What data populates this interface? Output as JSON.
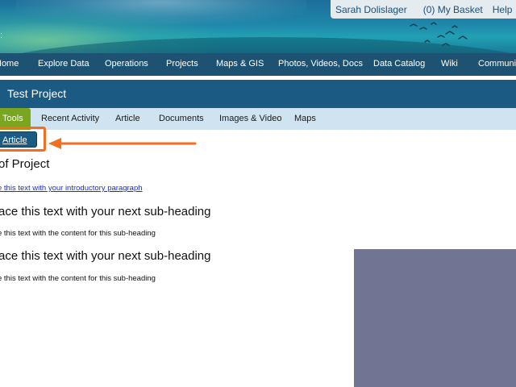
{
  "header": {
    "user_name": "Sarah Dolislager",
    "basket_label": "(0) My Basket",
    "help_label": "Help",
    "icons": {
      "settings": "gear-icon",
      "basket": "cart-icon"
    }
  },
  "main_nav": {
    "items": [
      {
        "label": "Home"
      },
      {
        "label": "Explore Data"
      },
      {
        "label": "Operations"
      },
      {
        "label": "Projects"
      },
      {
        "label": "Maps & GIS"
      },
      {
        "label": "Photos, Videos, Docs"
      },
      {
        "label": "Data Catalog"
      },
      {
        "label": "Wiki"
      },
      {
        "label": "Community"
      }
    ]
  },
  "project": {
    "title": "Test Project"
  },
  "sub_tabs": {
    "items": [
      {
        "label": "Tools",
        "active": true
      },
      {
        "label": "Recent Activity"
      },
      {
        "label": "Article"
      },
      {
        "label": "Documents"
      },
      {
        "label": "Images & Video"
      },
      {
        "label": "Maps"
      }
    ]
  },
  "action": {
    "label": "Article"
  },
  "article": {
    "heading": "of Project",
    "intro_link": "e this text with your introductory paragraph",
    "sections": [
      {
        "heading": "ace this text with your next sub-heading",
        "body": "e this text with the content for this sub-heading"
      },
      {
        "heading": "ace this text with your next sub-heading",
        "body": "e this text with the content for this sub-heading"
      }
    ]
  },
  "colors": {
    "nav_bg": "#1d5273",
    "project_bar": "#1b5a82",
    "subtab_bg": "#cfe3f1",
    "active_tab": "#7aa51f",
    "highlight": "#f26f22",
    "media_placeholder": "#717593"
  }
}
